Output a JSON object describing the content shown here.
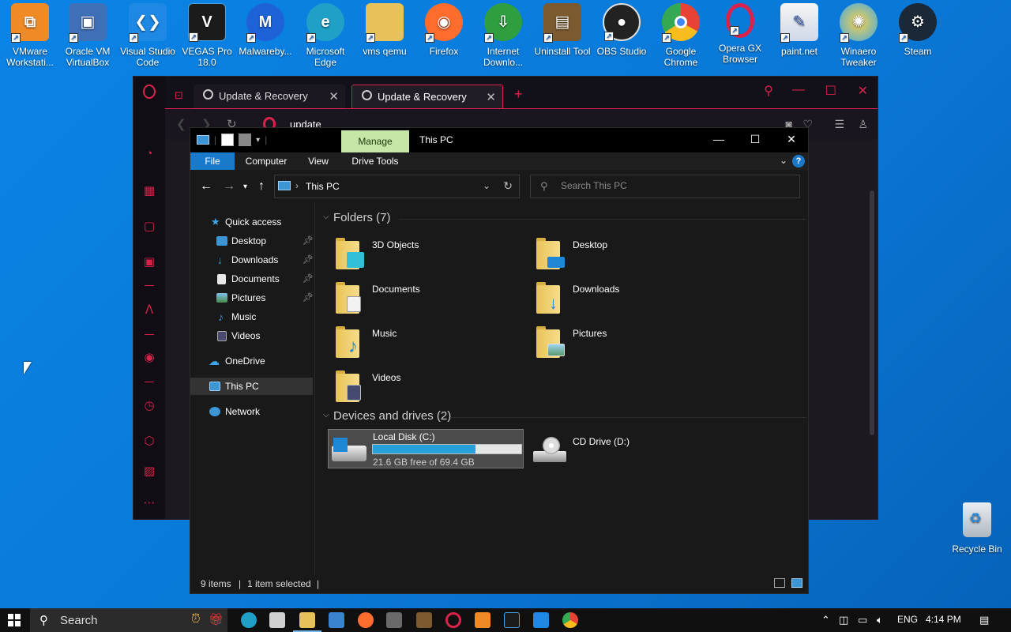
{
  "desktop": {
    "icons": [
      {
        "label": "VMware Workstati...",
        "color": "#f08a24"
      },
      {
        "label": "Oracle VM VirtualBox",
        "color": "#3f6fb6"
      },
      {
        "label": "Visual Studio Code",
        "color": "#1e88e5"
      },
      {
        "label": "VEGAS Pro 18.0",
        "color": "#1b1b1b"
      },
      {
        "label": "Malwareby...",
        "color": "#1e62d8"
      },
      {
        "label": "Microsoft Edge",
        "color": "#1fa0c6"
      },
      {
        "label": "vms qemu",
        "color": "#e7c25a"
      },
      {
        "label": "Firefox",
        "color": "#ff6d2d"
      },
      {
        "label": "Internet Downlo...",
        "color": "#2f9e3f"
      },
      {
        "label": "Uninstall Tool",
        "color": "#7a5a2e"
      },
      {
        "label": "OBS Studio",
        "color": "#222222"
      },
      {
        "label": "Google Chrome",
        "color": "#e84235"
      },
      {
        "label": "Opera GX Browser",
        "color": "#d9234b"
      },
      {
        "label": "paint.net",
        "color": "#3c5fb0"
      },
      {
        "label": "Winaero Tweaker",
        "color": "#f0b52a"
      },
      {
        "label": "Steam",
        "color": "#1b2838"
      }
    ],
    "recycle_bin": "Recycle Bin"
  },
  "opera": {
    "tabs": [
      {
        "label": "Update & Recovery"
      },
      {
        "label": "Update & Recovery"
      }
    ],
    "address": "update",
    "accent": "#d9234b"
  },
  "explorer": {
    "title": "This PC",
    "manage_tab": "Manage",
    "ribbon": {
      "file": "File",
      "computer": "Computer",
      "view": "View",
      "drive_tools": "Drive Tools",
      "help": "?"
    },
    "address_path": "This PC",
    "search_placeholder": "Search This PC",
    "nav": {
      "quick_access": "Quick access",
      "desktop": "Desktop",
      "downloads": "Downloads",
      "documents": "Documents",
      "pictures": "Pictures",
      "music": "Music",
      "videos": "Videos",
      "onedrive": "OneDrive",
      "this_pc": "This PC",
      "network": "Network"
    },
    "folders_header": "Folders (7)",
    "folders": [
      {
        "name": "3D Objects"
      },
      {
        "name": "Desktop"
      },
      {
        "name": "Documents"
      },
      {
        "name": "Downloads"
      },
      {
        "name": "Music"
      },
      {
        "name": "Pictures"
      },
      {
        "name": "Videos"
      }
    ],
    "devices_header": "Devices and drives (2)",
    "drives": [
      {
        "name": "Local Disk (C:)",
        "free_text": "21.6 GB free of 69.4 GB",
        "used_fraction": 0.69
      },
      {
        "name": "CD Drive (D:)"
      }
    ],
    "status": {
      "items": "9 items",
      "selected": "1 item selected"
    }
  },
  "taskbar": {
    "search": "Search",
    "lang": "ENG",
    "time": "4:14 PM"
  }
}
